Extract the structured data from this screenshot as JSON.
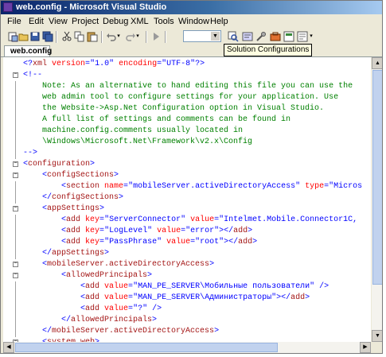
{
  "window": {
    "title": "web.config - Microsoft Visual Studio"
  },
  "menu": [
    "File",
    "Edit",
    "View",
    "Project",
    "Debug",
    "XML",
    "Tools",
    "Window",
    "Help"
  ],
  "toolbar": {
    "icons": [
      "new-project-icon",
      "open-file-icon",
      "save-icon",
      "save-all-icon",
      "cut-icon",
      "copy-icon",
      "paste-icon",
      "undo-icon",
      "redo-icon",
      "start-debug-icon",
      "find-icon",
      "solution-explorer-icon",
      "properties-icon",
      "toolbox-icon",
      "class-view-icon",
      "start-page-icon"
    ],
    "config_combo_value": "",
    "tooltip": "Solution Configurations"
  },
  "tab": {
    "label": "web.config"
  },
  "editor": {
    "lines": [
      {
        "fold": "",
        "text": [
          {
            "c": "t-pun",
            "t": "<?"
          },
          {
            "c": "t-tag",
            "t": "xml"
          },
          {
            "c": "t-attr",
            "t": " version"
          },
          {
            "c": "t-pun",
            "t": "="
          },
          {
            "c": "t-val",
            "t": "\"1.0\""
          },
          {
            "c": "t-attr",
            "t": " encoding"
          },
          {
            "c": "t-pun",
            "t": "="
          },
          {
            "c": "t-val",
            "t": "\"UTF-8\""
          },
          {
            "c": "t-pun",
            "t": "?>"
          }
        ]
      },
      {
        "fold": "−",
        "text": [
          {
            "c": "t-pun",
            "t": "<!--"
          }
        ]
      },
      {
        "fold": "|",
        "text": [
          {
            "c": "t-cmt",
            "t": "    Note: As an alternative to hand editing this file you can use the"
          }
        ]
      },
      {
        "fold": "|",
        "text": [
          {
            "c": "t-cmt",
            "t": "    web admin tool to configure settings for your application. Use"
          }
        ]
      },
      {
        "fold": "|",
        "text": [
          {
            "c": "t-cmt",
            "t": "    the Website->Asp.Net Configuration option in Visual Studio."
          }
        ]
      },
      {
        "fold": "|",
        "text": [
          {
            "c": "t-cmt",
            "t": "    A full list of settings and comments can be found in"
          }
        ]
      },
      {
        "fold": "|",
        "text": [
          {
            "c": "t-cmt",
            "t": "    machine.config.comments usually located in"
          }
        ]
      },
      {
        "fold": "|",
        "text": [
          {
            "c": "t-cmt",
            "t": "    \\Windows\\Microsoft.Net\\Framework\\v2.x\\Config"
          }
        ]
      },
      {
        "fold": "|",
        "text": [
          {
            "c": "t-pun",
            "t": "-->"
          }
        ]
      },
      {
        "fold": "−",
        "text": [
          {
            "c": "t-pun",
            "t": "<"
          },
          {
            "c": "t-tag",
            "t": "configuration"
          },
          {
            "c": "t-pun",
            "t": ">"
          }
        ]
      },
      {
        "fold": "−",
        "text": [
          {
            "c": "t-pun",
            "t": "    <"
          },
          {
            "c": "t-tag",
            "t": "configSections"
          },
          {
            "c": "t-pun",
            "t": ">"
          }
        ]
      },
      {
        "fold": "|",
        "text": [
          {
            "c": "t-pun",
            "t": "        <"
          },
          {
            "c": "t-tag",
            "t": "section"
          },
          {
            "c": "t-attr",
            "t": " name"
          },
          {
            "c": "t-pun",
            "t": "="
          },
          {
            "c": "t-val",
            "t": "\"mobileServer.activeDirectoryAccess\""
          },
          {
            "c": "t-attr",
            "t": " type"
          },
          {
            "c": "t-pun",
            "t": "="
          },
          {
            "c": "t-val",
            "t": "\"Micros"
          }
        ]
      },
      {
        "fold": "|",
        "text": [
          {
            "c": "t-pun",
            "t": "    </"
          },
          {
            "c": "t-tag",
            "t": "configSections"
          },
          {
            "c": "t-pun",
            "t": ">"
          }
        ]
      },
      {
        "fold": "−",
        "text": [
          {
            "c": "t-pun",
            "t": "    <"
          },
          {
            "c": "t-tag",
            "t": "appSettings"
          },
          {
            "c": "t-pun",
            "t": ">"
          }
        ]
      },
      {
        "fold": "|",
        "text": [
          {
            "c": "t-pun",
            "t": "        <"
          },
          {
            "c": "t-tag",
            "t": "add"
          },
          {
            "c": "t-attr",
            "t": " key"
          },
          {
            "c": "t-pun",
            "t": "="
          },
          {
            "c": "t-val",
            "t": "\"ServerConnector\""
          },
          {
            "c": "t-attr",
            "t": " value"
          },
          {
            "c": "t-pun",
            "t": "="
          },
          {
            "c": "t-val",
            "t": "\"Intelmet.Mobile.Connector1C,"
          }
        ]
      },
      {
        "fold": "|",
        "text": [
          {
            "c": "t-pun",
            "t": "        <"
          },
          {
            "c": "t-tag",
            "t": "add"
          },
          {
            "c": "t-attr",
            "t": " key"
          },
          {
            "c": "t-pun",
            "t": "="
          },
          {
            "c": "t-val",
            "t": "\"LogLevel\""
          },
          {
            "c": "t-attr",
            "t": " value"
          },
          {
            "c": "t-pun",
            "t": "="
          },
          {
            "c": "t-val",
            "t": "\"error\""
          },
          {
            "c": "t-pun",
            "t": "></"
          },
          {
            "c": "t-tag",
            "t": "add"
          },
          {
            "c": "t-pun",
            "t": ">"
          }
        ]
      },
      {
        "fold": "|",
        "text": [
          {
            "c": "t-pun",
            "t": "        <"
          },
          {
            "c": "t-tag",
            "t": "add"
          },
          {
            "c": "t-attr",
            "t": " key"
          },
          {
            "c": "t-pun",
            "t": "="
          },
          {
            "c": "t-val",
            "t": "\"PassPhrase\""
          },
          {
            "c": "t-attr",
            "t": " value"
          },
          {
            "c": "t-pun",
            "t": "="
          },
          {
            "c": "t-val",
            "t": "\"root\""
          },
          {
            "c": "t-pun",
            "t": "></"
          },
          {
            "c": "t-tag",
            "t": "add"
          },
          {
            "c": "t-pun",
            "t": ">"
          }
        ]
      },
      {
        "fold": "|",
        "text": [
          {
            "c": "t-pun",
            "t": "    </"
          },
          {
            "c": "t-tag",
            "t": "appSettings"
          },
          {
            "c": "t-pun",
            "t": ">"
          }
        ]
      },
      {
        "fold": "−",
        "text": [
          {
            "c": "t-pun",
            "t": "    <"
          },
          {
            "c": "t-tag",
            "t": "mobileServer.activeDirectoryAccess"
          },
          {
            "c": "t-pun",
            "t": ">"
          }
        ]
      },
      {
        "fold": "−",
        "text": [
          {
            "c": "t-pun",
            "t": "        <"
          },
          {
            "c": "t-tag",
            "t": "allowedPrincipals"
          },
          {
            "c": "t-pun",
            "t": ">"
          }
        ]
      },
      {
        "fold": "|",
        "text": [
          {
            "c": "t-pun",
            "t": "            <"
          },
          {
            "c": "t-tag",
            "t": "add"
          },
          {
            "c": "t-attr",
            "t": " value"
          },
          {
            "c": "t-pun",
            "t": "="
          },
          {
            "c": "t-val",
            "t": "\"MAN_PE_SERVER\\Мобильные пользователи\""
          },
          {
            "c": "t-pun",
            "t": " />"
          }
        ]
      },
      {
        "fold": "|",
        "text": [
          {
            "c": "t-pun",
            "t": "            <"
          },
          {
            "c": "t-tag",
            "t": "add"
          },
          {
            "c": "t-attr",
            "t": " value"
          },
          {
            "c": "t-pun",
            "t": "="
          },
          {
            "c": "t-val",
            "t": "\"MAN_PE_SERVER\\Администраторы\""
          },
          {
            "c": "t-pun",
            "t": "></"
          },
          {
            "c": "t-tag",
            "t": "add"
          },
          {
            "c": "t-pun",
            "t": ">"
          }
        ]
      },
      {
        "fold": "|",
        "text": [
          {
            "c": "t-pun",
            "t": "            <"
          },
          {
            "c": "t-tag",
            "t": "add"
          },
          {
            "c": "t-attr",
            "t": " value"
          },
          {
            "c": "t-pun",
            "t": "="
          },
          {
            "c": "t-val",
            "t": "\"?\""
          },
          {
            "c": "t-pun",
            "t": " />"
          }
        ]
      },
      {
        "fold": "|",
        "text": [
          {
            "c": "t-pun",
            "t": "        </"
          },
          {
            "c": "t-tag",
            "t": "allowedPrincipals"
          },
          {
            "c": "t-pun",
            "t": ">"
          }
        ]
      },
      {
        "fold": "|",
        "text": [
          {
            "c": "t-pun",
            "t": "    </"
          },
          {
            "c": "t-tag",
            "t": "mobileServer.activeDirectoryAccess"
          },
          {
            "c": "t-pun",
            "t": ">"
          }
        ]
      },
      {
        "fold": "−",
        "text": [
          {
            "c": "t-pun",
            "t": "    <"
          },
          {
            "c": "t-tag",
            "t": "system.web"
          },
          {
            "c": "t-pun",
            "t": ">"
          }
        ]
      },
      {
        "fold": "−",
        "text": [
          {
            "c": "t-pun",
            "t": "        <!--"
          }
        ]
      }
    ]
  }
}
